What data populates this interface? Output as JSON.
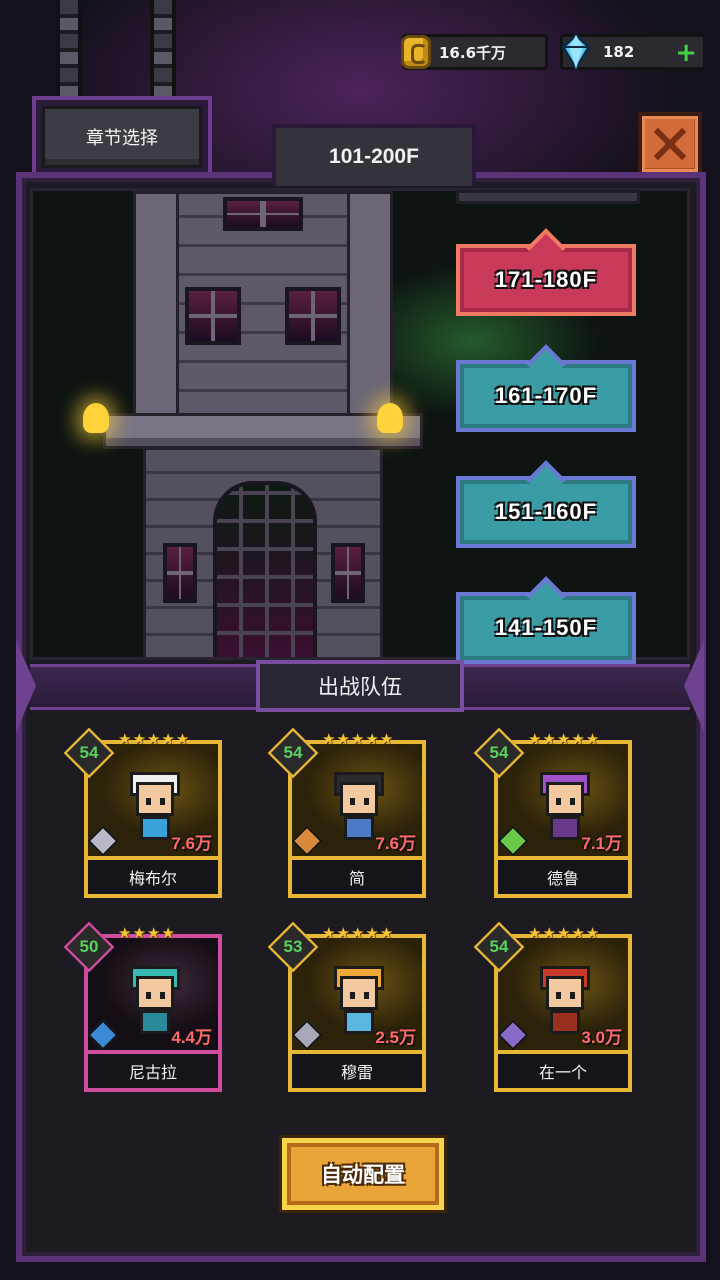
{
  "currency": {
    "gold_value": "16.6千万",
    "gem_value": "182",
    "add_symbol": "+"
  },
  "header": {
    "chapter_button": "章节选择",
    "floor_range": "101-200F"
  },
  "floors": [
    {
      "label": "171-180F",
      "state": "selected",
      "color": "#c8395a"
    },
    {
      "label": "161-170F",
      "state": "normal",
      "color": "#3a9ca4"
    },
    {
      "label": "151-160F",
      "state": "normal",
      "color": "#3a9ca4"
    },
    {
      "label": "141-150F",
      "state": "normal",
      "color": "#3a9ca4"
    }
  ],
  "team": {
    "title": "出战队伍",
    "heroes": [
      {
        "name": "梅布尔",
        "level": "54",
        "stars": "★★★★★",
        "power": "7.6万",
        "frame": "gold",
        "hair": "#f0f0f0",
        "outfit": "#3aa0d8",
        "role_color": "#b8b8c8"
      },
      {
        "name": "简",
        "level": "54",
        "stars": "★★★★★",
        "power": "7.6万",
        "frame": "gold",
        "hair": "#2a2a30",
        "outfit": "#4a7ac8",
        "role_color": "#d88a3a"
      },
      {
        "name": "德鲁",
        "level": "54",
        "stars": "★★★★★",
        "power": "7.1万",
        "frame": "gold",
        "hair": "#a050c8",
        "outfit": "#6a3a8a",
        "role_color": "#6ac84a"
      },
      {
        "name": "尼古拉",
        "level": "50",
        "stars": "★★★★",
        "power": "4.4万",
        "frame": "pink",
        "hair": "#38b8b0",
        "outfit": "#2a8a9a",
        "role_color": "#3a8ad8"
      },
      {
        "name": "穆雷",
        "level": "53",
        "stars": "★★★★★",
        "power": "2.5万",
        "frame": "gold",
        "hair": "#f0a838",
        "outfit": "#5ab8e0",
        "role_color": "#a8a8b8"
      },
      {
        "name": "在一个",
        "level": "54",
        "stars": "★★★★★",
        "power": "3.0万",
        "frame": "gold",
        "hair": "#c83a2a",
        "outfit": "#9a3020",
        "role_color": "#8a6ac8"
      }
    ]
  },
  "actions": {
    "auto_button": "自动配置"
  }
}
